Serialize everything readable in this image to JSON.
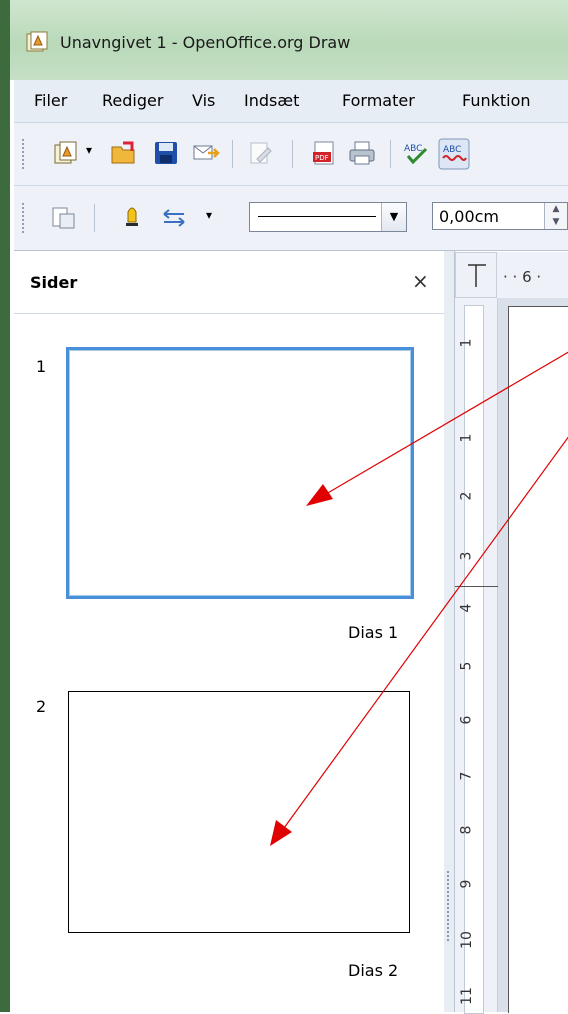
{
  "window": {
    "title": "Unavngivet 1 - OpenOffice.org Draw"
  },
  "menubar": {
    "items": [
      {
        "label": "Filer"
      },
      {
        "label": "Rediger"
      },
      {
        "label": "Vis"
      },
      {
        "label": "Indsæt"
      },
      {
        "label": "Formater"
      },
      {
        "label": "Funktion"
      }
    ]
  },
  "toolbar": {
    "icons": [
      "new-document-icon",
      "dropdown-arrow-icon",
      "open-folder-icon",
      "save-icon",
      "email-icon",
      "edit-file-icon",
      "export-pdf-icon",
      "print-icon",
      "spellcheck-icon",
      "autospellcheck-icon"
    ]
  },
  "line_toolbar": {
    "line_style": "solid",
    "line_width": "0,00cm"
  },
  "slides_panel": {
    "title": "Sider",
    "close_symbol": "×",
    "slides": [
      {
        "number": "1",
        "label": "Dias 1",
        "selected": true
      },
      {
        "number": "2",
        "label": "Dias 2",
        "selected": false
      }
    ]
  },
  "rulers": {
    "horizontal_text": "· · 6 ·",
    "vertical_labels": [
      "1",
      "1",
      "2",
      "3",
      "4",
      "5",
      "6",
      "7",
      "8",
      "9",
      "10",
      "11"
    ]
  },
  "colors": {
    "selection_border": "#4a90d9",
    "annotation_arrow": "#e00000",
    "title_bar": "#cfe6cf"
  }
}
